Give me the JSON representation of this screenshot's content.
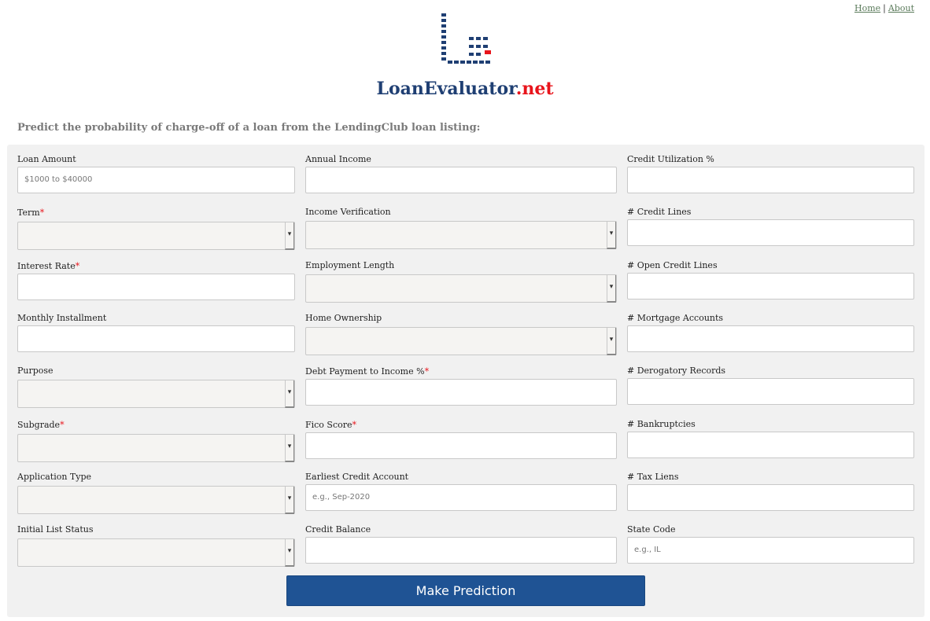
{
  "nav": {
    "home": "Home",
    "separator": "|",
    "about": "About"
  },
  "brand": {
    "name": "LoanEvaluator",
    "tld": ".net"
  },
  "colors": {
    "brand_blue": "#1f3f73",
    "brand_red": "#e8141b",
    "button": "#1f5394",
    "panel": "#f1f1f1"
  },
  "subtitle": "Predict the probability of charge-off of a loan from the LendingClub loan listing:",
  "columns": [
    [
      {
        "label": "Loan Amount",
        "required": false,
        "type": "input",
        "placeholder": "$1000 to $40000"
      },
      {
        "label": "Term",
        "required": true,
        "type": "select"
      },
      {
        "label": "Interest Rate",
        "required": true,
        "type": "input",
        "placeholder": ""
      },
      {
        "label": "Monthly Installment",
        "required": false,
        "type": "input",
        "placeholder": ""
      },
      {
        "label": "Purpose",
        "required": false,
        "type": "select"
      },
      {
        "label": "Subgrade",
        "required": true,
        "type": "select"
      },
      {
        "label": "Application Type",
        "required": false,
        "type": "select"
      },
      {
        "label": "Initial List Status",
        "required": false,
        "type": "select"
      }
    ],
    [
      {
        "label": "Annual Income",
        "required": false,
        "type": "input",
        "placeholder": ""
      },
      {
        "label": "Income Verification",
        "required": false,
        "type": "select"
      },
      {
        "label": "Employment Length",
        "required": false,
        "type": "select"
      },
      {
        "label": "Home Ownership",
        "required": false,
        "type": "select"
      },
      {
        "label": "Debt Payment to Income %",
        "required": true,
        "type": "input",
        "placeholder": ""
      },
      {
        "label": "Fico Score",
        "required": true,
        "type": "input",
        "placeholder": ""
      },
      {
        "label": "Earliest Credit Account",
        "required": false,
        "type": "input",
        "placeholder": "e.g., Sep-2020"
      },
      {
        "label": "Credit Balance",
        "required": false,
        "type": "input",
        "placeholder": ""
      }
    ],
    [
      {
        "label": "Credit Utilization %",
        "required": false,
        "type": "input",
        "placeholder": ""
      },
      {
        "label": "# Credit Lines",
        "required": false,
        "type": "input",
        "placeholder": ""
      },
      {
        "label": "# Open Credit Lines",
        "required": false,
        "type": "input",
        "placeholder": ""
      },
      {
        "label": "# Mortgage Accounts",
        "required": false,
        "type": "input",
        "placeholder": ""
      },
      {
        "label": "# Derogatory Records",
        "required": false,
        "type": "input",
        "placeholder": ""
      },
      {
        "label": "# Bankruptcies",
        "required": false,
        "type": "input",
        "placeholder": ""
      },
      {
        "label": "# Tax Liens",
        "required": false,
        "type": "input",
        "placeholder": ""
      },
      {
        "label": "State Code",
        "required": false,
        "type": "input",
        "placeholder": "e.g., IL"
      }
    ]
  ],
  "submit_label": "Make Prediction"
}
